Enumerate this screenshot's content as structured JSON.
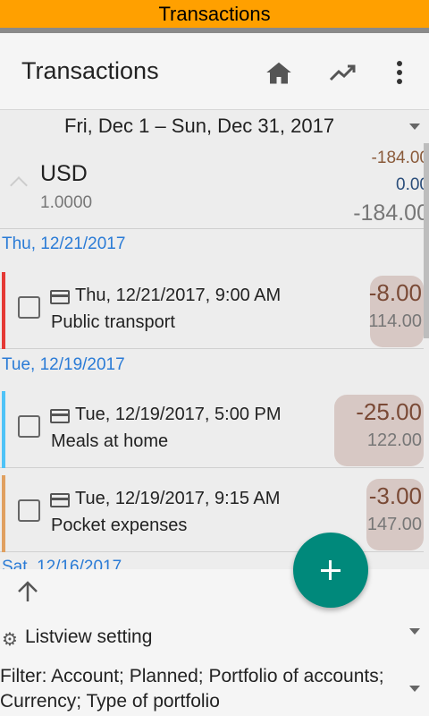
{
  "window": {
    "title": "Transactions"
  },
  "appbar": {
    "title": "Transactions",
    "icons": [
      "home-icon",
      "trending-up-icon",
      "more-vert-icon"
    ]
  },
  "date_range": {
    "label": "Fri, Dec 1 – Sun, Dec 31, 2017"
  },
  "currency": {
    "code": "USD",
    "rate": "1.0000",
    "expense": "-184.00",
    "income": "0.00",
    "total": "-184.00"
  },
  "groups": [
    {
      "header": "Thu, 12/21/2017",
      "transactions": [
        {
          "datetime": "Thu, 12/21/2017, 9:00 AM",
          "description": "Public transport",
          "amount": "-8.00",
          "balance": "114.00",
          "bar_color": "#e53935"
        }
      ]
    },
    {
      "header": "Tue, 12/19/2017",
      "transactions": [
        {
          "datetime": "Tue, 12/19/2017, 5:00 PM",
          "description": "Meals at home",
          "amount": "-25.00",
          "balance": "122.00",
          "bar_color": "#4fc3f7"
        },
        {
          "datetime": "Tue, 12/19/2017, 9:15 AM",
          "description": "Pocket expenses",
          "amount": "-3.00",
          "balance": "147.00",
          "bar_color": "#e0a060"
        }
      ]
    }
  ],
  "partial_header": "Sat, 12/16/2017",
  "bottom": {
    "listview_setting": "Listview setting",
    "filter": "Filter: Account; Planned; Portfolio of accounts; Currency; Type of portfolio"
  },
  "colors": {
    "titlebar": "#ffa000",
    "fab": "#00897b",
    "day_header": "#2a7bd6"
  }
}
